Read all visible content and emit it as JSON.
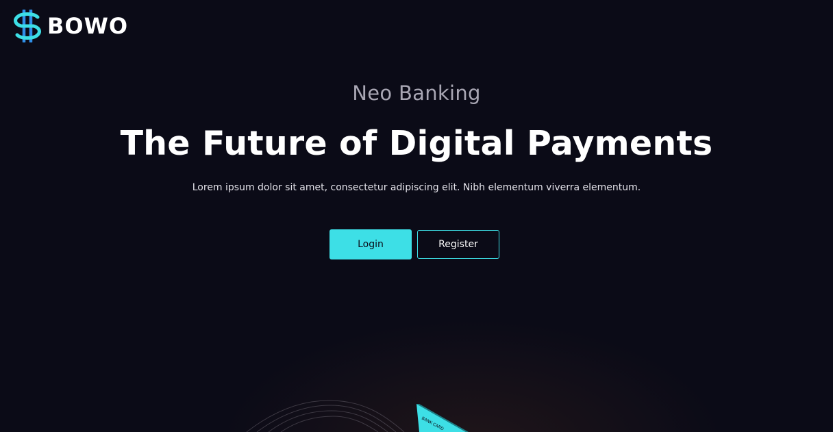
{
  "brand": {
    "name": "BOWO",
    "icon": "bowo-logo-icon",
    "accent_color": "#3ddfe6",
    "icon_color": "#2f8fe8"
  },
  "hero": {
    "eyebrow": "Neo Banking",
    "headline": "The Future of Digital Payments",
    "subtext": "Lorem ipsum dolor sit amet, consectetur adipiscing elit. Nibh elementum viverra elementum."
  },
  "actions": {
    "login_label": "Login",
    "register_label": "Register"
  },
  "illustration": {
    "card_label": "BANK CARD",
    "card_color": "#3ddfe6"
  },
  "colors": {
    "background": "#0b0b17",
    "text_primary": "#ffffff",
    "text_muted": "#a9a7b4"
  }
}
